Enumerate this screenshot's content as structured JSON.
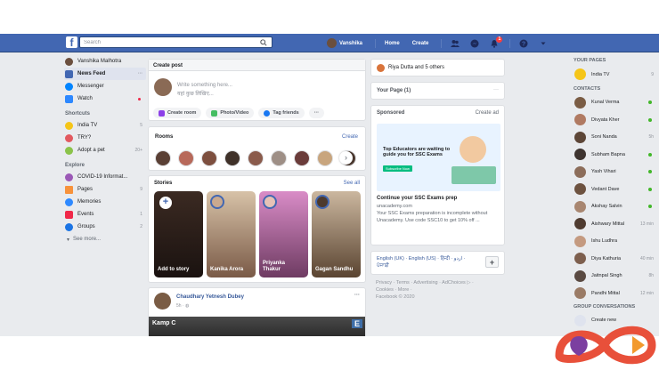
{
  "topbar": {
    "logo": "f",
    "search_placeholder": "Search",
    "user": "Vanshika",
    "home": "Home",
    "create": "Create",
    "notif_count": "1"
  },
  "left": {
    "profile_name": "Vanshika Malhotra",
    "items": [
      {
        "label": "News Feed",
        "count": "···"
      },
      {
        "label": "Messenger",
        "count": ""
      },
      {
        "label": "Watch",
        "count": ""
      }
    ],
    "shortcuts_title": "Shortcuts",
    "shortcuts": [
      {
        "label": "India TV",
        "count": "5"
      },
      {
        "label": "TRY?",
        "count": ""
      },
      {
        "label": "Adopt a pet",
        "count": "20+"
      }
    ],
    "explore_title": "Explore",
    "explore": [
      {
        "label": "COVID-19 Informat...",
        "count": ""
      },
      {
        "label": "Pages",
        "count": "9"
      },
      {
        "label": "Memories",
        "count": ""
      },
      {
        "label": "Events",
        "count": "1"
      },
      {
        "label": "Groups",
        "count": "2"
      }
    ],
    "see_more": "See more..."
  },
  "create_post": {
    "title": "Create post",
    "placeholder_line1": "Write something here...",
    "placeholder_line2": "यहां कुछ लिखिए...",
    "buttons": [
      "Create room",
      "Photo/Video",
      "Tag friends"
    ],
    "more": "···"
  },
  "rooms": {
    "title": "Rooms",
    "link": "Create"
  },
  "stories": {
    "title": "Stories",
    "link": "See all",
    "items": [
      "Add to story",
      "Kanika Arora",
      "Priyanka Thakur",
      "Gagan Sandhu"
    ]
  },
  "post": {
    "author": "Chaudhary Yetnesh Dubey",
    "time": "5h · ",
    "more": "···",
    "image_text": "Kamp C",
    "image_badge": "E"
  },
  "right_cards": {
    "friends_line": "Riya Dutta and 5 others",
    "your_page": "Your Page (1)",
    "your_page_more": "···",
    "sponsored": "Sponsored",
    "create_ad": "Create ad",
    "ad_image_line1": "Top Educators are waiting to",
    "ad_image_line2": "guide you for SSC Exams",
    "ad_image_btn": "Subscribe Now",
    "ad_title": "Continue your SSC Exams prep",
    "ad_domain": "unacademy.com",
    "ad_body": "Your SSC Exams preparation is incomplete without Unacademy. Use code SSC10 to get 10% off ...",
    "lang_line1": "English (UK) · English (US) · हिन्दी · اردو ·",
    "lang_line2": "ਪੰਜਾਬੀ",
    "lang_plus": "+",
    "footer_line1": "Privacy · Terms · Advertising · AdChoices ▷ ·",
    "footer_line2": "Cookies · More ·",
    "footer_line3": "Facebook © 2020"
  },
  "right": {
    "your_pages_title": "YOUR PAGES",
    "page_name": "India TV",
    "page_count": "9",
    "contacts_title": "CONTACTS",
    "contacts": [
      {
        "name": "Kunal Verma",
        "status": "online"
      },
      {
        "name": "Divyata Kher",
        "status": "online"
      },
      {
        "name": "Soni Nanda",
        "status": "5h"
      },
      {
        "name": "Subham Bapna",
        "status": "online"
      },
      {
        "name": "Yash Vihari",
        "status": "online"
      },
      {
        "name": "Vedant Dave",
        "status": "online"
      },
      {
        "name": "Akshay Salvin",
        "status": "online"
      },
      {
        "name": "Aishwary Mittal",
        "status": "13 min"
      },
      {
        "name": "Ishu Ludhra",
        "status": ""
      },
      {
        "name": "Diya Kathuria",
        "status": "40 min"
      },
      {
        "name": "Jaitnpal Singh",
        "status": "8h"
      },
      {
        "name": "Pandhi Mittal",
        "status": "12 min"
      }
    ],
    "group_title": "GROUP CONVERSATIONS",
    "create_new": "Create new"
  },
  "colors": {
    "brand": "#4267b2",
    "online": "#42b72a",
    "link": "#4267b2"
  }
}
